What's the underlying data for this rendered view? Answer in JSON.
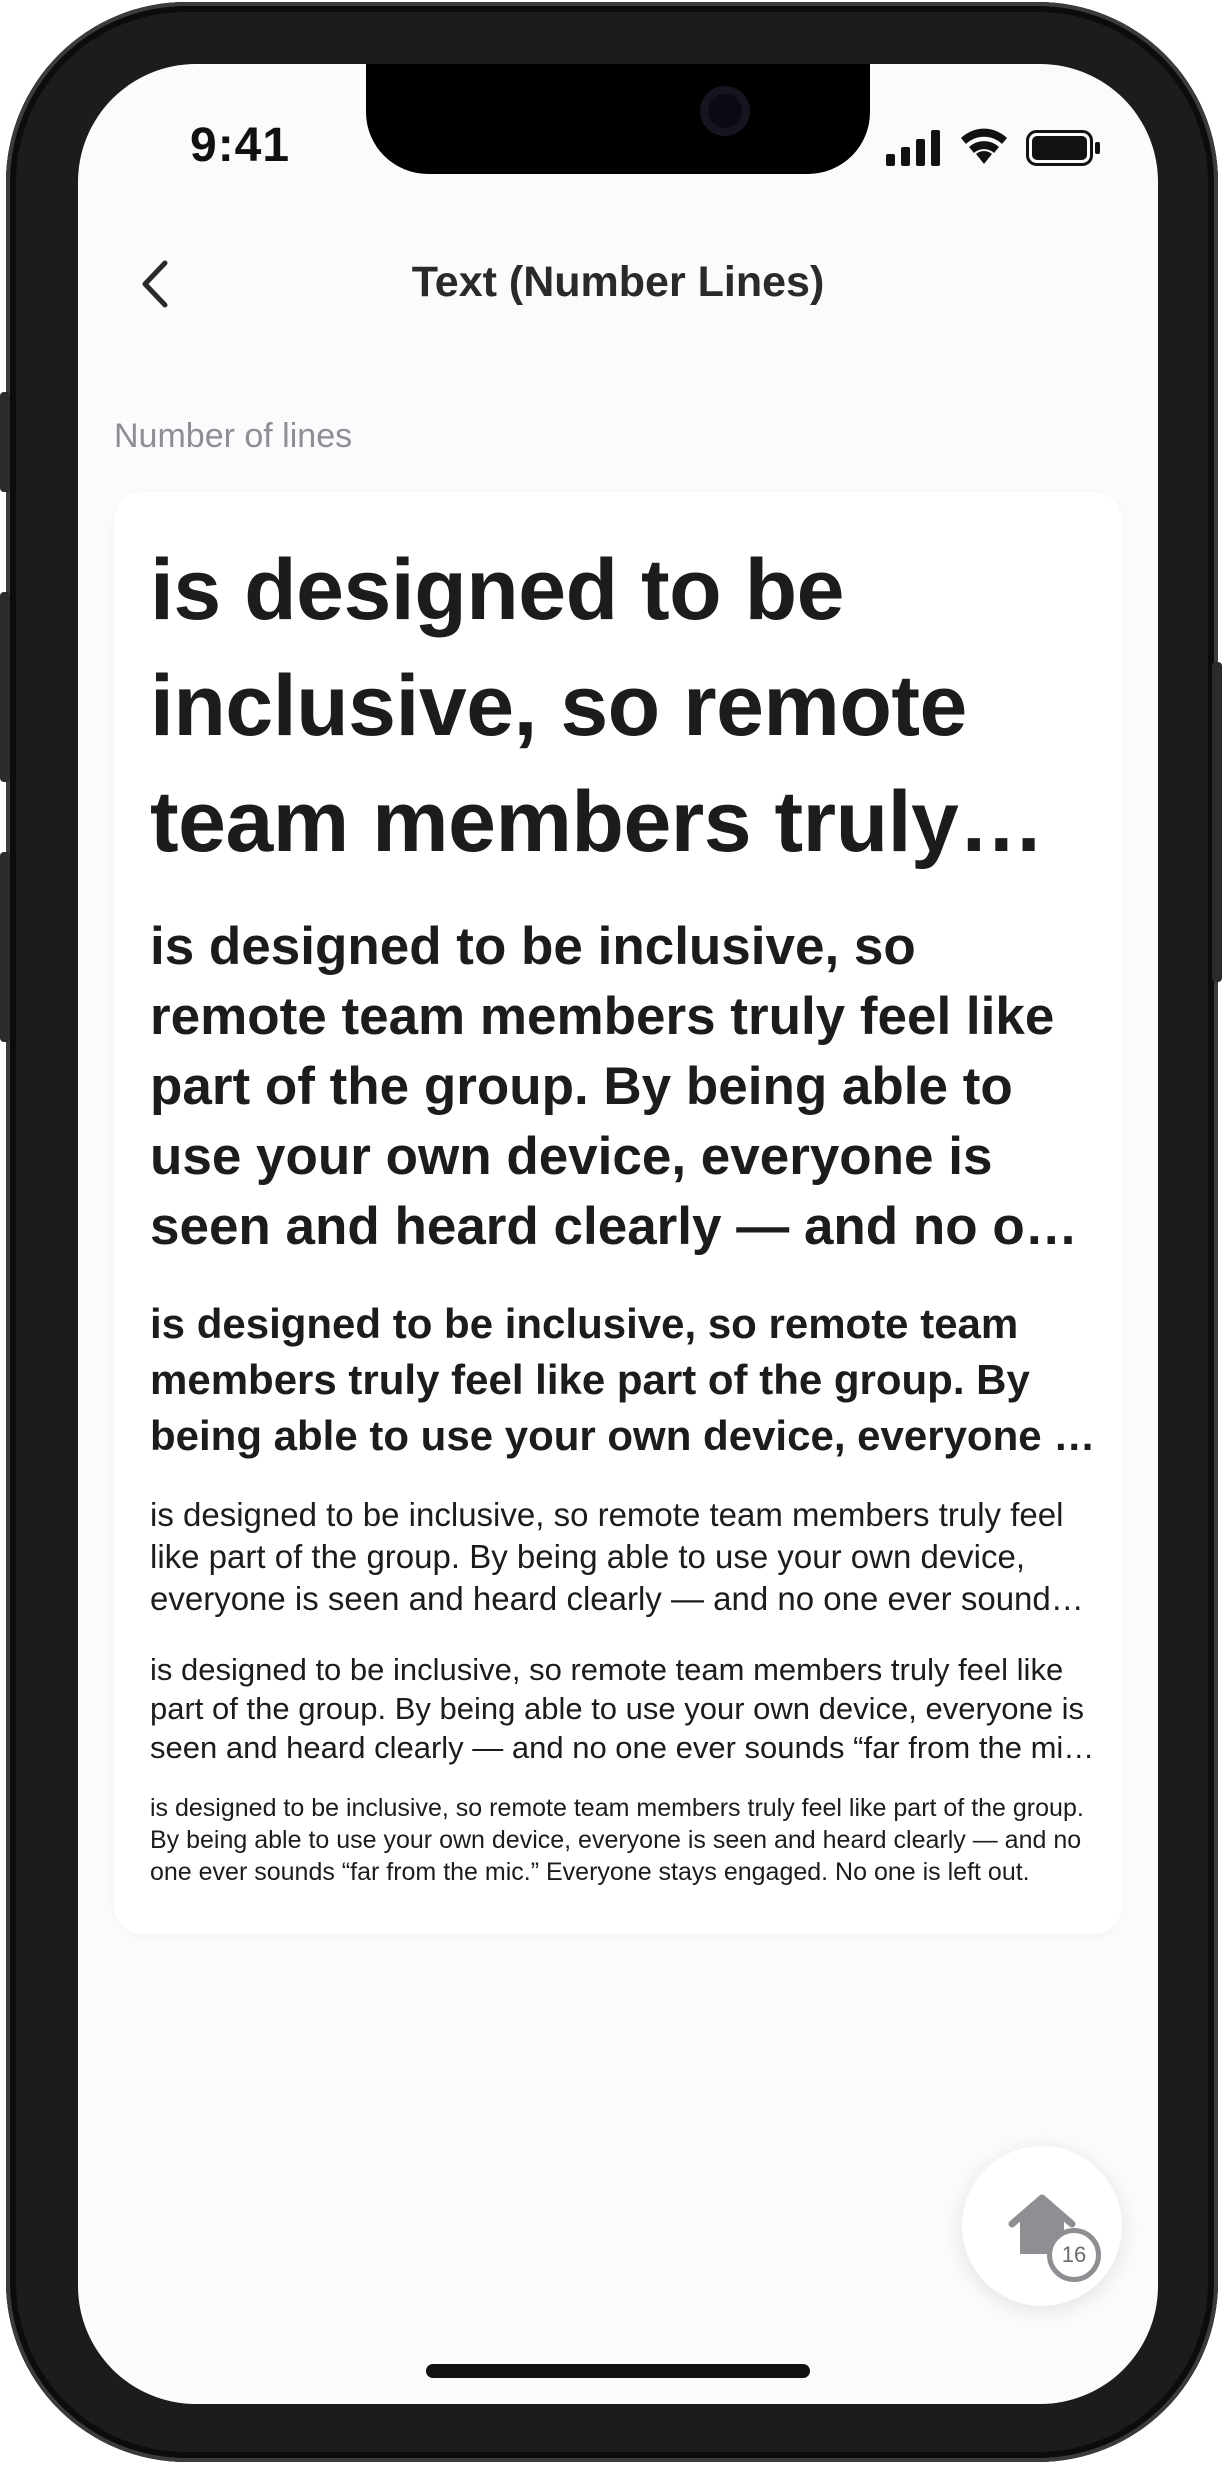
{
  "status_bar": {
    "time": "9:41"
  },
  "header": {
    "title": "Text (Number Lines)"
  },
  "section": {
    "label": "Number of lines"
  },
  "samples": [
    {
      "max_lines": 3,
      "text": "is designed to be inclusive, so remote team members truly feel like part of the group. By being able to use your own device, everyone is seen and heard clearly — and no one ever sounds “far from the mic.” Everyone stays engaged. No one is left out."
    },
    {
      "max_lines": 5,
      "text": "is designed to be inclusive, so remote team members truly feel like part of the group. By being able to use your own device, everyone is seen and heard clearly — and no one ever sounds “far from the mic.” Everyone stays engaged. No one is left out."
    },
    {
      "max_lines": 3,
      "text": "is designed to be inclusive, so remote team members truly feel like part of the group. By being able to use your own device, everyone is seen and heard clearly — and no one ever sounds “far from the mic.” Everyone stays engaged. No one is left out."
    },
    {
      "max_lines": 3,
      "text": "is designed to be inclusive, so remote team members truly feel like part of the group. By being able to use your own device, everyone is seen and heard clearly — and no one ever sounds “far from the mic.” Everyone stays engaged. No one is left out."
    },
    {
      "max_lines": 3,
      "text": "is designed to be inclusive, so remote team members truly feel like part of the group. By being able to use your own device, everyone is seen and heard clearly — and no one ever sounds “far from the mic.” Everyone stays engaged. No one is left out."
    },
    {
      "max_lines": 3,
      "text": "is designed to be inclusive, so remote team members truly feel like part of the group. By being able to use your own device, everyone is seen and heard clearly — and no one ever sounds “far from the mic.” Everyone stays engaged. No one is left out."
    }
  ],
  "fab": {
    "badge": "16",
    "icon": "house-icon"
  },
  "colors": {
    "background": "#fbfafc",
    "text": "#1c1c1e",
    "secondary": "#8e8e93"
  }
}
